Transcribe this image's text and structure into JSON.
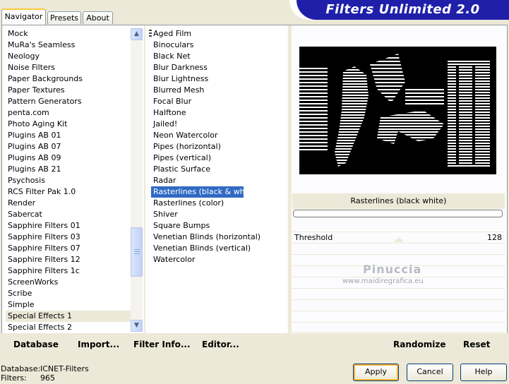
{
  "tabs": [
    "Navigator",
    "Presets",
    "About"
  ],
  "banner_title": "Filters Unlimited 2.0",
  "categories": [
    "Mock",
    "MuRa's Seamless",
    "Neology",
    "Noise Filters",
    "Paper Backgrounds",
    "Paper Textures",
    "Pattern Generators",
    "penta.com",
    "Photo Aging Kit",
    "Plugins AB 01",
    "Plugins AB 07",
    "Plugins AB 09",
    "Plugins AB 21",
    "Psychosis",
    "RCS Filter Pak 1.0",
    "Render",
    "Sabercat",
    "Sapphire Filters 01",
    "Sapphire Filters 03",
    "Sapphire Filters 07",
    "Sapphire Filters 12",
    "Sapphire Filters 1c",
    "ScreenWorks",
    "Scribe",
    "Simple",
    "Special Effects 1",
    "Special Effects 2"
  ],
  "selected_category": "Special Effects 1",
  "filters": [
    "Aged Film",
    "Binoculars",
    "Black Net",
    "Blur Darkness",
    "Blur Lightness",
    "Blurred Mesh",
    "Focal Blur",
    "Halftone",
    "Jailed!",
    "Neon Watercolor",
    "Pipes (horizontal)",
    "Pipes (vertical)",
    "Plastic Surface",
    "Radar",
    "Rasterlines (black & white)",
    "Rasterlines (color)",
    "Shiver",
    "Square Bumps",
    "Venetian Blinds (horizontal)",
    "Venetian Blinds (vertical)",
    "Watercolor"
  ],
  "selected_filter": "Rasterlines (black & white)",
  "filter_panel": {
    "name": "Rasterlines (black  white)",
    "param_label": "Threshold",
    "param_value": "128"
  },
  "watermark": {
    "name": "Pinuccia",
    "url": "www.maidiregrafica.eu"
  },
  "toolbar": {
    "database": "Database",
    "import": "Import...",
    "filter_info": "Filter Info...",
    "editor": "Editor...",
    "randomize": "Randomize",
    "reset": "Reset"
  },
  "status": {
    "database_label": "Database:",
    "database_value": "ICNET-Filters",
    "filters_label": "Filters:",
    "filters_value": "965"
  },
  "buttons": {
    "apply": "Apply",
    "cancel": "Cancel",
    "help": "Help"
  },
  "colors": {
    "selection": "#316ac5",
    "banner": "#1f1faa",
    "accent_tab": "#ffc83c"
  }
}
